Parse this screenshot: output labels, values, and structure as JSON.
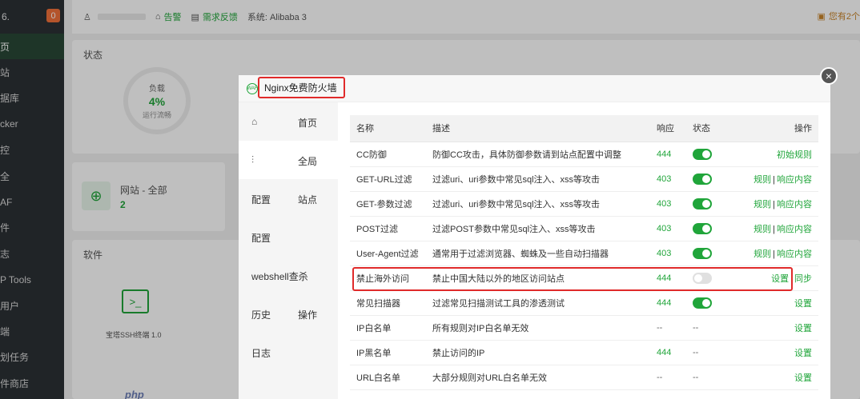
{
  "sidebar": {
    "server_ip": "6.",
    "badge": "0",
    "items": [
      {
        "label": "页",
        "active": true
      },
      {
        "label": "站"
      },
      {
        "label": "据库"
      },
      {
        "label": "cker"
      },
      {
        "label": "控"
      },
      {
        "label": "全"
      },
      {
        "label": "AF"
      },
      {
        "label": "件"
      },
      {
        "label": "志"
      },
      {
        "label": "P Tools"
      },
      {
        "label": "用户"
      },
      {
        "label": "端"
      },
      {
        "label": "划任务"
      },
      {
        "label": "件商店"
      }
    ]
  },
  "topbar": {
    "user": "",
    "alert": "告警",
    "feedback": "需求反馈",
    "system": "系统: Alibaba 3",
    "notice": "您有2个"
  },
  "status_panel": {
    "title": "状态",
    "gauge_label": "负载",
    "gauge_value": "4%",
    "gauge_sub": "运行流畅"
  },
  "site_panel": {
    "label": "网站 - 全部",
    "count": "2"
  },
  "software_panel": {
    "title": "软件",
    "item": "宝塔SSH终端 1.0",
    "php": "php"
  },
  "modal": {
    "title": "Nginx免费防火墙",
    "waf_icon": "WAF",
    "close": "×",
    "nav": [
      {
        "icon": "⌂",
        "label": "首页"
      },
      {
        "icon": "⫶",
        "label": "全局",
        "active": true
      },
      {
        "label_long": "配置",
        "label": "站点"
      },
      {
        "label_long": "配置"
      },
      {
        "label_long": "webshell查杀"
      },
      {
        "label_long": "历史",
        "label": "操作"
      },
      {
        "label_long": "日志"
      }
    ],
    "table": {
      "headers": {
        "name": "名称",
        "desc": "描述",
        "resp": "响应",
        "status": "状态",
        "op": "操作"
      },
      "rows": [
        {
          "name": "CC防御",
          "desc": "防御CC攻击，具体防御参数请到站点配置中调整",
          "resp": "444",
          "status": "on",
          "ops": [
            "初始规则"
          ]
        },
        {
          "name": "GET-URL过滤",
          "desc": "过滤uri、uri参数中常见sql注入、xss等攻击",
          "resp": "403",
          "status": "on",
          "ops": [
            "规则",
            "响应内容"
          ]
        },
        {
          "name": "GET-参数过滤",
          "desc": "过滤uri、uri参数中常见sql注入、xss等攻击",
          "resp": "403",
          "status": "on",
          "ops": [
            "规则",
            "响应内容"
          ]
        },
        {
          "name": "POST过滤",
          "desc": "过滤POST参数中常见sql注入、xss等攻击",
          "resp": "403",
          "status": "on",
          "ops": [
            "规则",
            "响应内容"
          ]
        },
        {
          "name": "User-Agent过滤",
          "desc": "通常用于过滤浏览器、蜘蛛及一些自动扫描器",
          "resp": "403",
          "status": "on",
          "ops": [
            "规则",
            "响应内容"
          ]
        },
        {
          "name": "禁止海外访问",
          "desc": "禁止中国大陆以外的地区访问站点",
          "resp": "444",
          "status": "off",
          "ops": [
            "设置",
            "同步"
          ]
        },
        {
          "name": "常见扫描器",
          "desc": "过滤常见扫描测试工具的渗透测试",
          "resp": "444",
          "status": "on",
          "ops": [
            "设置"
          ]
        },
        {
          "name": "IP白名单",
          "desc": "所有规则对IP白名单无效",
          "resp": "--",
          "status": "--",
          "ops": [
            "设置"
          ]
        },
        {
          "name": "IP黑名单",
          "desc": "禁止访问的IP",
          "resp": "444",
          "status": "--",
          "ops": [
            "设置"
          ]
        },
        {
          "name": "URL白名单",
          "desc": "大部分规则对URL白名单无效",
          "resp": "--",
          "status": "--",
          "ops": [
            "设置"
          ]
        }
      ]
    }
  },
  "colors": {
    "accent": "#20a53a",
    "highlight": "#e02a2a",
    "sidebar": "#2b3035"
  }
}
